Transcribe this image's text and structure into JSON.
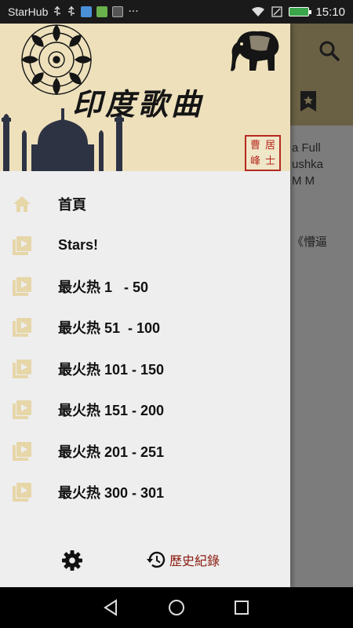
{
  "status_bar": {
    "carrier": "StarHub",
    "time": "15:10",
    "more": "···"
  },
  "app": {
    "title": "印度歌曲",
    "seal_text": [
      "曹",
      "居",
      "峰",
      "士"
    ]
  },
  "background_content": {
    "lines": [
      "a Full",
      "ushka",
      "M M",
      "《懵逼"
    ]
  },
  "menu": {
    "items": [
      {
        "label": "首頁",
        "icon": "home-icon"
      },
      {
        "label": "Stars!",
        "icon": "video-library-icon"
      },
      {
        "label": "最火热 1   - 50",
        "icon": "video-library-icon"
      },
      {
        "label": "最火热 51  - 100",
        "icon": "video-library-icon"
      },
      {
        "label": "最火热 101 - 150",
        "icon": "video-library-icon"
      },
      {
        "label": "最火热 151 - 200",
        "icon": "video-library-icon"
      },
      {
        "label": "最火热 201 - 251",
        "icon": "video-library-icon"
      },
      {
        "label": "最火热 300 - 301",
        "icon": "video-library-icon"
      }
    ]
  },
  "footer": {
    "history_label": "歷史紀錄",
    "settings_icon": "gear-icon",
    "history_icon": "history-icon"
  },
  "colors": {
    "header_bg": "#ede0bb",
    "drawer_bg": "#eeeeee",
    "icon_tint": "#e6d6a8",
    "history_text": "#8a1a10",
    "seal": "#b52a1f"
  }
}
